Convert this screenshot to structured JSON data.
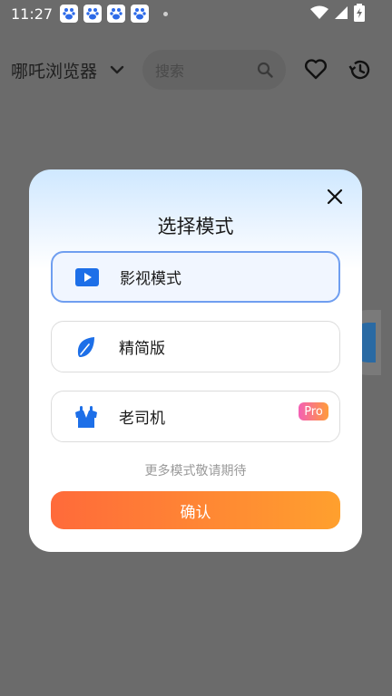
{
  "status_bar": {
    "time": "11:27"
  },
  "header": {
    "app_title": "哪吒浏览器",
    "search_placeholder": "搜索"
  },
  "icons": {
    "chevron": "chevron-down-icon",
    "search": "search-icon",
    "favorite": "heart-icon",
    "history": "history-icon",
    "close": "close-icon",
    "video": "video-play-icon",
    "lite": "leaf-icon",
    "senior": "vest-icon"
  },
  "modal": {
    "title": "选择模式",
    "options": [
      {
        "label": "影视模式",
        "selected": true
      },
      {
        "label": "精简版",
        "selected": false
      },
      {
        "label": "老司机",
        "selected": false,
        "badge": "Pro"
      }
    ],
    "hint": "更多模式敬请期待",
    "confirm_label": "确认"
  },
  "colors": {
    "accent_blue": "#1d6fe8",
    "selected_border": "#6f9ef0",
    "confirm_start": "#ff6a3a",
    "confirm_end": "#ffa02e",
    "overlay": "#6b6b6b"
  }
}
